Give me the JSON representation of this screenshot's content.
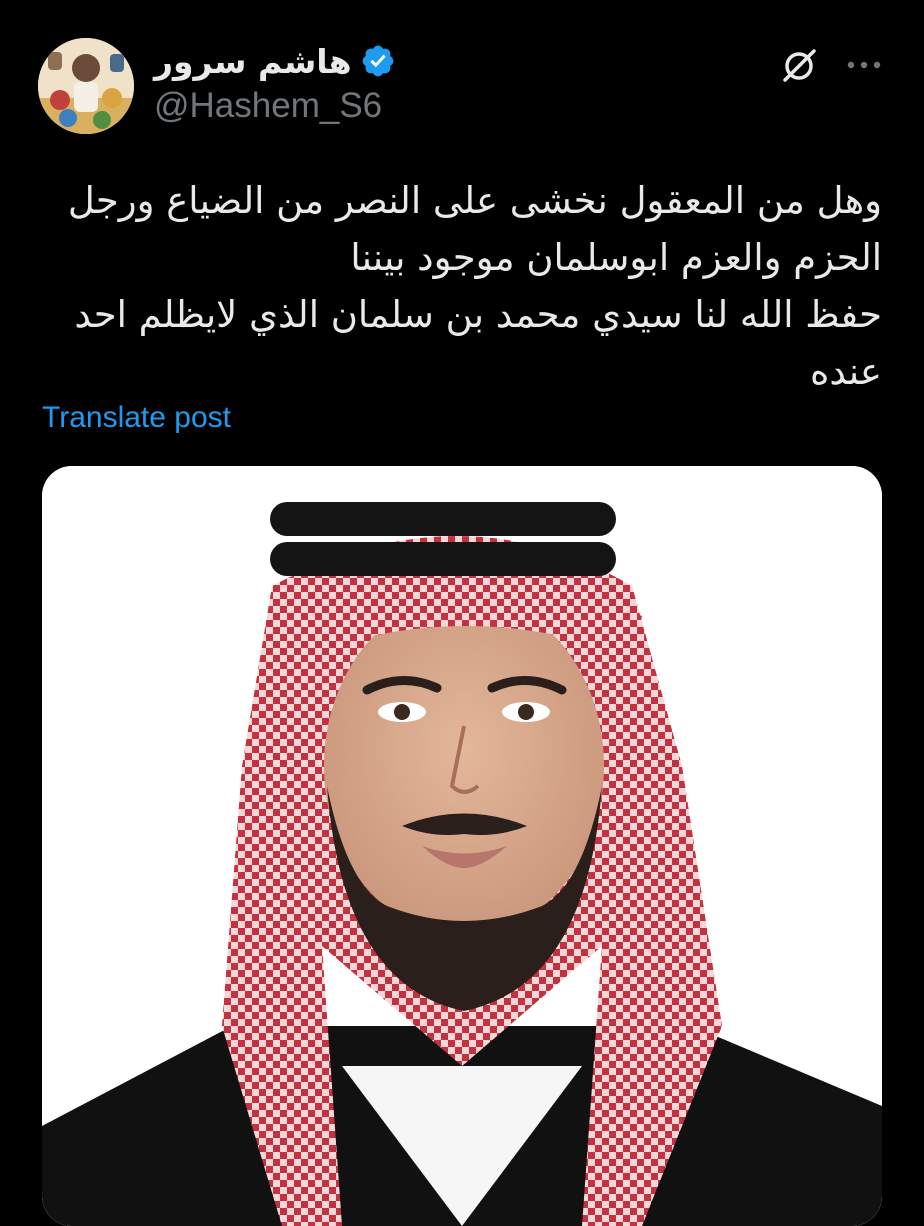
{
  "post": {
    "author": {
      "display_name": "هاشم سرور",
      "handle": "@Hashem_S6",
      "verified": true,
      "verified_color": "#1d9bf0"
    },
    "text_lines": [
      "وهل من المعقول نخشى على النصر من الضياع ورجل",
      "الحزم والعزم ابوسلمان موجود بيننا",
      "حفظ الله لنا سيدي محمد بن سلمان الذي لايظلم احد",
      "عنده"
    ],
    "translate_label": "Translate post",
    "icons": {
      "grok": "grok-slash-icon",
      "more": "more-horizontal-icon",
      "verified": "verified-badge-icon"
    },
    "media": {
      "kind": "photo"
    }
  },
  "colors": {
    "background": "#000000",
    "text": "#e7e9ea",
    "secondary_text": "#71767b",
    "link": "#1d9bf0"
  }
}
